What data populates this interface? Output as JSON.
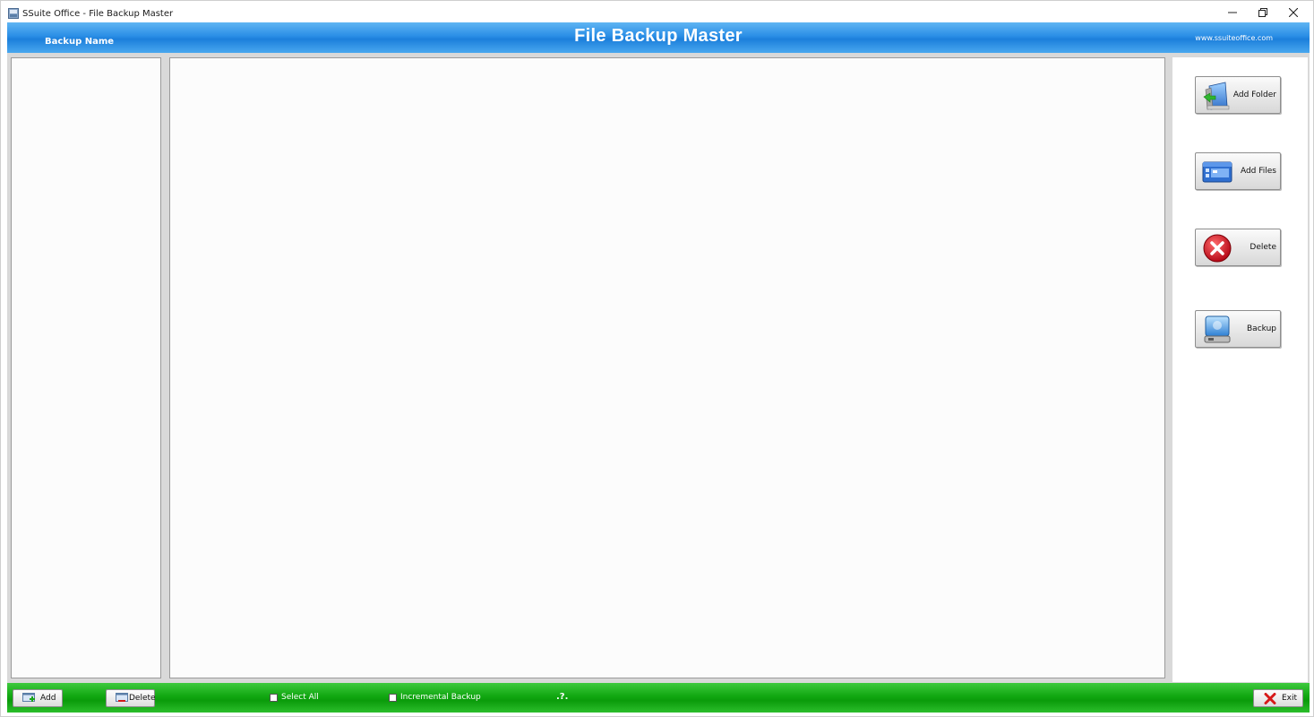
{
  "window": {
    "title": "SSuite Office - File Backup Master",
    "controls": {
      "minimize": "–",
      "restore": "❐",
      "close": "✕"
    }
  },
  "header": {
    "left_label": "Backup Name",
    "title": "File Backup Master",
    "website": "www.ssuiteoffice.com",
    "color": "#1c7fdb"
  },
  "side_buttons": [
    {
      "label": "Add Folder",
      "icon": "folder-add-icon"
    },
    {
      "label": "Add Files",
      "icon": "files-add-icon"
    },
    {
      "label": "Delete",
      "icon": "delete-icon"
    },
    {
      "label": "Backup",
      "icon": "drive-backup-icon"
    }
  ],
  "footer": {
    "add_label": "Add",
    "delete_label": "Delete",
    "select_all_label": "Select All",
    "select_all_checked": false,
    "incremental_label": "Incremental Backup",
    "incremental_checked": false,
    "help_label": ".?.",
    "exit_label": "Exit",
    "color": "#0b9b0b"
  }
}
